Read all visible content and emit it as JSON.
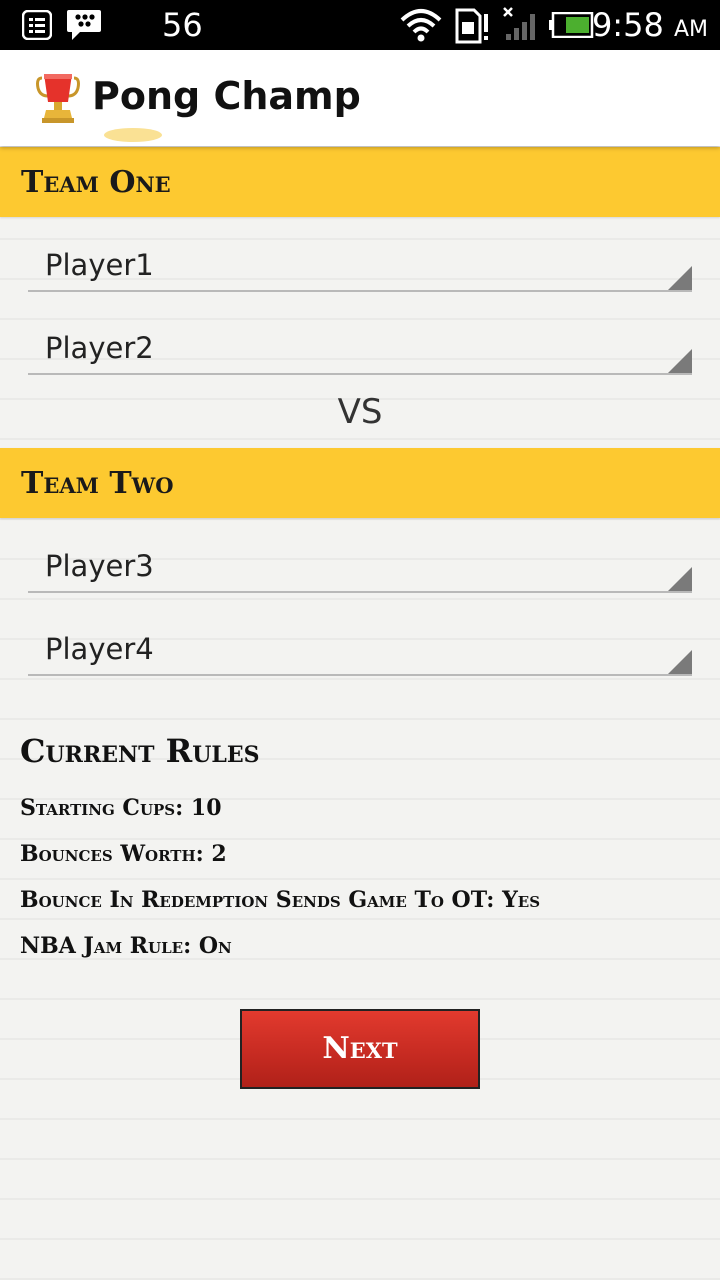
{
  "status_bar": {
    "notification_count": "56",
    "time": "9:58",
    "ampm": "AM",
    "icons": [
      "menu-icon",
      "bbm-icon",
      "wifi-icon",
      "sim-alert-icon",
      "signal-icon",
      "battery-icon"
    ]
  },
  "app": {
    "title": "Pong Champ",
    "logo_icon": "trophy-cup-icon"
  },
  "team_one": {
    "header": "Team One",
    "players": [
      "Player1",
      "Player2"
    ]
  },
  "vs_label": "VS",
  "team_two": {
    "header": "Team Two",
    "players": [
      "Player3",
      "Player4"
    ]
  },
  "rules": {
    "title": "Current Rules",
    "items": [
      "Starting Cups: 10",
      "Bounces Worth: 2",
      "Bounce In Redemption Sends Game To OT: Yes",
      "NBA Jam Rule: On"
    ]
  },
  "next_button": {
    "label": "Next"
  },
  "colors": {
    "header_yellow": "#fdc930",
    "button_red": "#c52a21",
    "background": "#f3f3f1"
  }
}
